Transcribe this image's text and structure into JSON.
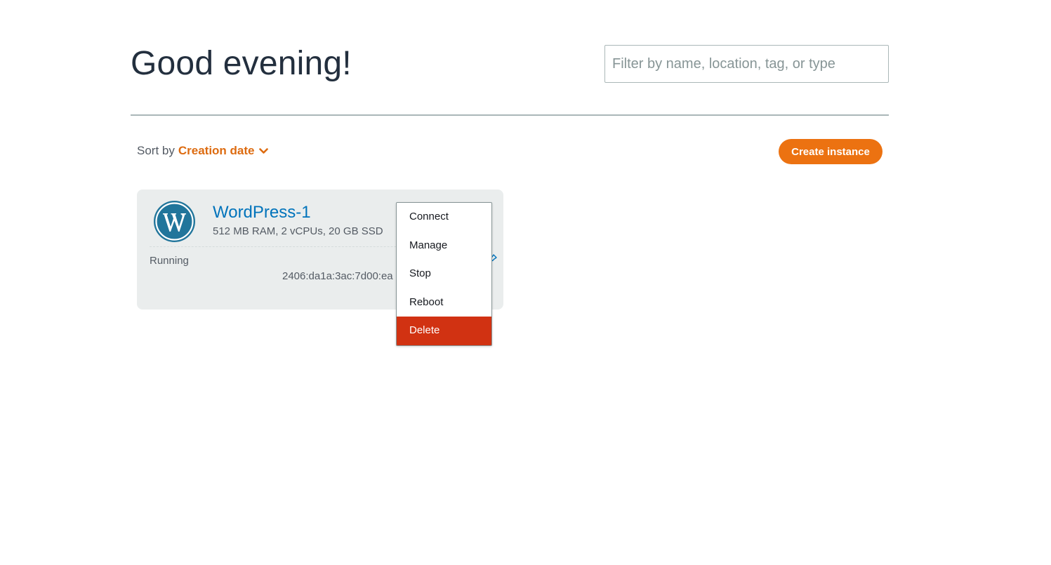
{
  "header": {
    "greeting": "Good evening!",
    "filter_placeholder": "Filter by name, location, tag, or type"
  },
  "toolbar": {
    "sort_label": "Sort by",
    "sort_value": "Creation date",
    "create_label": "Create instance"
  },
  "instance": {
    "name": "WordPress-1",
    "spec": "512 MB RAM, 2 vCPUs, 20 GB SSD",
    "status": "Running",
    "ip": "2406:da1a:3ac:7d00:ea",
    "icon": "wordpress-logo-icon"
  },
  "menu": {
    "items": [
      {
        "label": "Connect"
      },
      {
        "label": "Manage"
      },
      {
        "label": "Stop"
      },
      {
        "label": "Reboot"
      },
      {
        "label": "Delete"
      }
    ]
  },
  "colors": {
    "accent": "#ec7211",
    "sort_accent": "#dd6b10",
    "link": "#0073bb",
    "danger": "#d13212",
    "card_bg": "#eaeded"
  }
}
